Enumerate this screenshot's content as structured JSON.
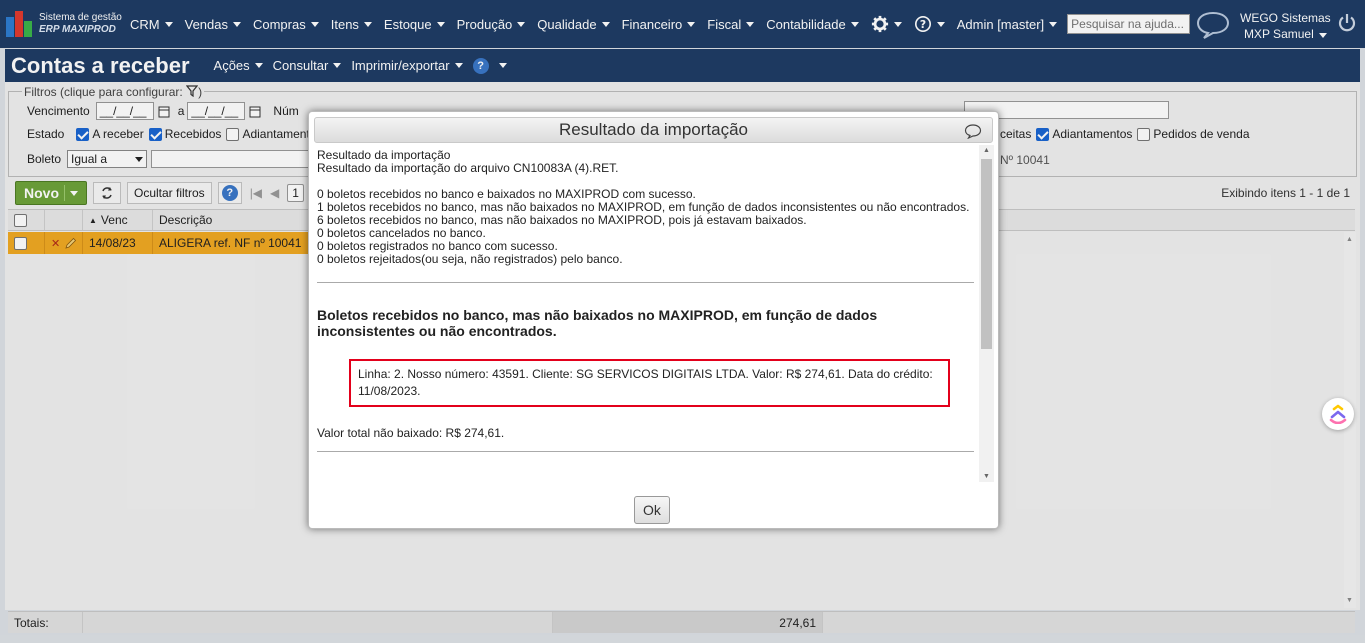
{
  "app": {
    "logo_line1": "Sistema de gestão",
    "logo_line2": "ERP MAXIPROD"
  },
  "nav": [
    {
      "label": "CRM"
    },
    {
      "label": "Vendas"
    },
    {
      "label": "Compras"
    },
    {
      "label": "Itens"
    },
    {
      "label": "Estoque"
    },
    {
      "label": "Produção"
    },
    {
      "label": "Qualidade"
    },
    {
      "label": "Financeiro"
    },
    {
      "label": "Fiscal"
    },
    {
      "label": "Contabilidade"
    }
  ],
  "user_menu": "Admin [master]",
  "help_search": {
    "placeholder": "Pesquisar na ajuda..."
  },
  "company": {
    "name": "WEGO Sistemas",
    "user": "MXP Samuel"
  },
  "page": {
    "title": "Contas a receber",
    "menus": [
      {
        "label": "Ações"
      },
      {
        "label": "Consultar"
      },
      {
        "label": "Imprimir/exportar"
      }
    ]
  },
  "filters": {
    "legend": "Filtros (clique para configurar:",
    "vencimento_label": "Vencimento",
    "date_placeholder": "__/__/__",
    "a_label": "a",
    "numero_label": "Núm",
    "estado_label": "Estado",
    "estado_options": [
      {
        "label": "A receber",
        "checked": true
      },
      {
        "label": "Recebidos",
        "checked": true
      },
      {
        "label": "Adiantament",
        "checked": false
      }
    ],
    "right_options": [
      {
        "label": "ceitas",
        "checked": true
      },
      {
        "label": "Adiantamentos",
        "checked": true
      },
      {
        "label": "Pedidos de venda",
        "checked": false
      }
    ],
    "boleto_label": "Boleto",
    "boleto_value": "Igual a",
    "nf_text": "Nº 10041"
  },
  "toolbar": {
    "novo": "Novo",
    "ocultar": "Ocultar filtros",
    "page": "1",
    "counter": "Exibindo itens 1 - 1 de 1"
  },
  "grid": {
    "headers": {
      "venc": "Venc",
      "descricao": "Descrição"
    },
    "row": {
      "venc": "14/08/23",
      "descricao": "ALIGERA ref. NF nº 10041"
    },
    "totals_label": "Totais:",
    "totals_value": "274,61"
  },
  "modal": {
    "title": "Resultado da importação",
    "intro1": "Resultado da importação",
    "intro2": "Resultado da importação do arquivo CN10083A (4).RET.",
    "summary": [
      "0 boletos recebidos no banco e baixados no MAXIPROD com sucesso.",
      "1 boletos recebidos no banco, mas não baixados no MAXIPROD, em função de dados inconsistentes ou não encontrados.",
      "6 boletos recebidos no banco, mas não baixados no MAXIPROD, pois já estavam baixados.",
      "0 boletos cancelados no banco.",
      "0 boletos registrados no banco com sucesso.",
      "0 boletos rejeitados(ou seja, não registrados) pelo banco."
    ],
    "section_heading": "Boletos recebidos no banco, mas não baixados no MAXIPROD, em função de dados inconsistentes ou não encontrados.",
    "record": "Linha: 2. Nosso número: 43591. Cliente: SG SERVICOS DIGITAIS LTDA. Valor: R$ 274,61. Data do crédito: 11/08/2023.",
    "total": "Valor total não baixado: R$ 274,61.",
    "ok": "Ok"
  }
}
